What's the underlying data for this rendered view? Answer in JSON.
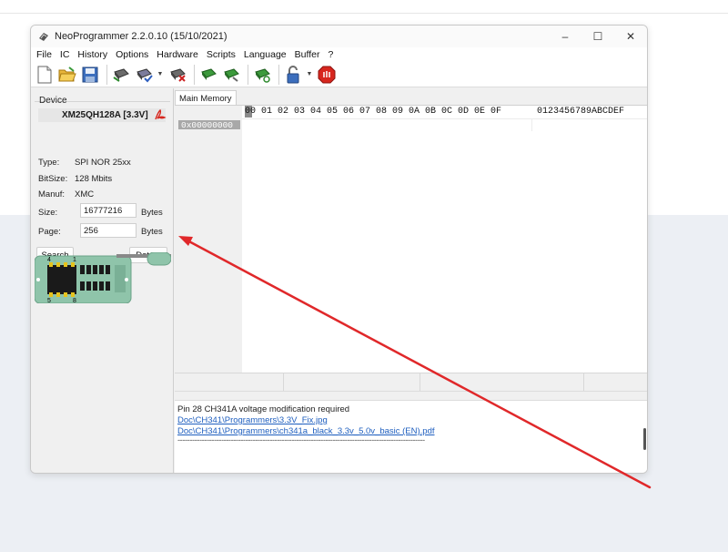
{
  "window": {
    "title": "NeoProgrammer 2.2.0.10 (15/10/2021)",
    "controls": {
      "minimize": "–",
      "maximize": "☐",
      "close": "✕"
    }
  },
  "menu": [
    "File",
    "IC",
    "History",
    "Options",
    "Hardware",
    "Scripts",
    "Language",
    "Buffer",
    "?"
  ],
  "toolbar": {
    "icons": [
      "new-file-icon",
      "open-folder-icon",
      "save-icon",
      "read-chip-icon",
      "verify-chip-icon",
      "erase-chip-icon",
      "write-chip-icon",
      "program-chip-icon",
      "auto-chip-icon",
      "unlock-icon",
      "stop-icon"
    ]
  },
  "device": {
    "group_label": "Device",
    "name": "XM25QH128A [3.3V]",
    "type_label": "Type:",
    "type_value": "SPI NOR 25xx",
    "bitsize_label": "BitSize:",
    "bitsize_value": "128 Mbits",
    "manuf_label": "Manuf:",
    "manuf_value": "XMC",
    "size_label": "Size:",
    "size_value": "16777216",
    "size_unit": "Bytes",
    "page_label": "Page:",
    "page_value": "256",
    "page_unit": "Bytes",
    "search_button": "Search",
    "detect_button": "Detect"
  },
  "chip_diagram": {
    "pin_top_left": "4",
    "pin_top_right": "1",
    "pin_bottom_left": "5",
    "pin_bottom_right": "8"
  },
  "hex_view": {
    "tab_label": "Main Memory",
    "header_bytes": "00 01 02 03 04 05 06 07 08 09 0A 0B 0C 0D 0E 0F",
    "ascii_header": "0123456789ABCDEF",
    "first_address": "0x00000000"
  },
  "log": {
    "line1": "Pin 28 CH341A voltage modification required",
    "link1": "Doc\\CH341\\Programmers\\3.3V_Fix.jpg",
    "link2": "Doc\\CH341\\Programmers\\ch341a_black_3.3v_5.0v_basic (EN).pdf",
    "separator": "------------------------------------------------------------------------------------------------------"
  },
  "colors": {
    "annotation_arrow": "#e0282a",
    "chip_board": "#8fc4aa",
    "link": "#1f5fbf"
  }
}
